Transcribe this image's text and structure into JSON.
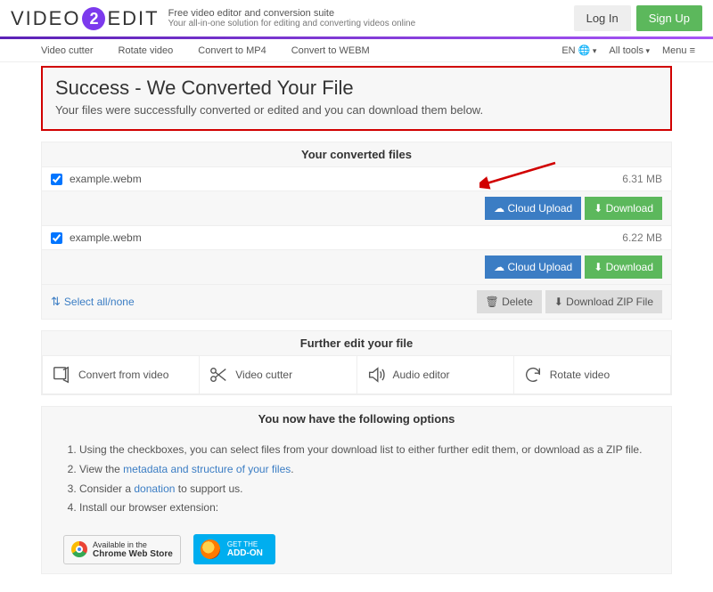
{
  "brand": {
    "v": "VIDEO",
    "two": "2",
    "e": "EDIT",
    "tag1": "Free video editor and conversion suite",
    "tag2": "Your all-in-one solution for editing and converting videos online"
  },
  "auth": {
    "login": "Log In",
    "signup": "Sign Up"
  },
  "toolbar": {
    "cutter": "Video cutter",
    "rotate": "Rotate video",
    "mp4": "Convert to MP4",
    "webm": "Convert to WEBM",
    "lang": "EN",
    "tools": "All tools",
    "menu": "Menu"
  },
  "success": {
    "title": "Success - We Converted Your File",
    "sub": "Your files were successfully converted or edited and you can download them below."
  },
  "files": {
    "heading": "Your converted files",
    "items": [
      {
        "name": "example.webm",
        "size": "6.31 MB"
      },
      {
        "name": "example.webm",
        "size": "6.22 MB"
      }
    ],
    "cloud": "Cloud Upload",
    "download": "Download",
    "selectall": "Select all/none",
    "delete": "Delete",
    "zip": "Download ZIP File"
  },
  "further": {
    "heading": "Further edit your file",
    "convert": "Convert from video",
    "cutter": "Video cutter",
    "audio": "Audio editor",
    "rotate": "Rotate video"
  },
  "opts": {
    "heading": "You now have the following options",
    "i1a": "Using the checkboxes, you can select files from your download list to either further edit them, or download as a ZIP file.",
    "i2a": "View the ",
    "i2b": "metadata and structure of your files",
    "i2c": ".",
    "i3a": "Consider a ",
    "i3b": "donation",
    "i3c": " to support us.",
    "i4": "Install our browser extension:",
    "chrome1": "Available in the",
    "chrome2": "Chrome Web Store",
    "ff1": "GET THE",
    "ff2": "ADD-ON"
  }
}
